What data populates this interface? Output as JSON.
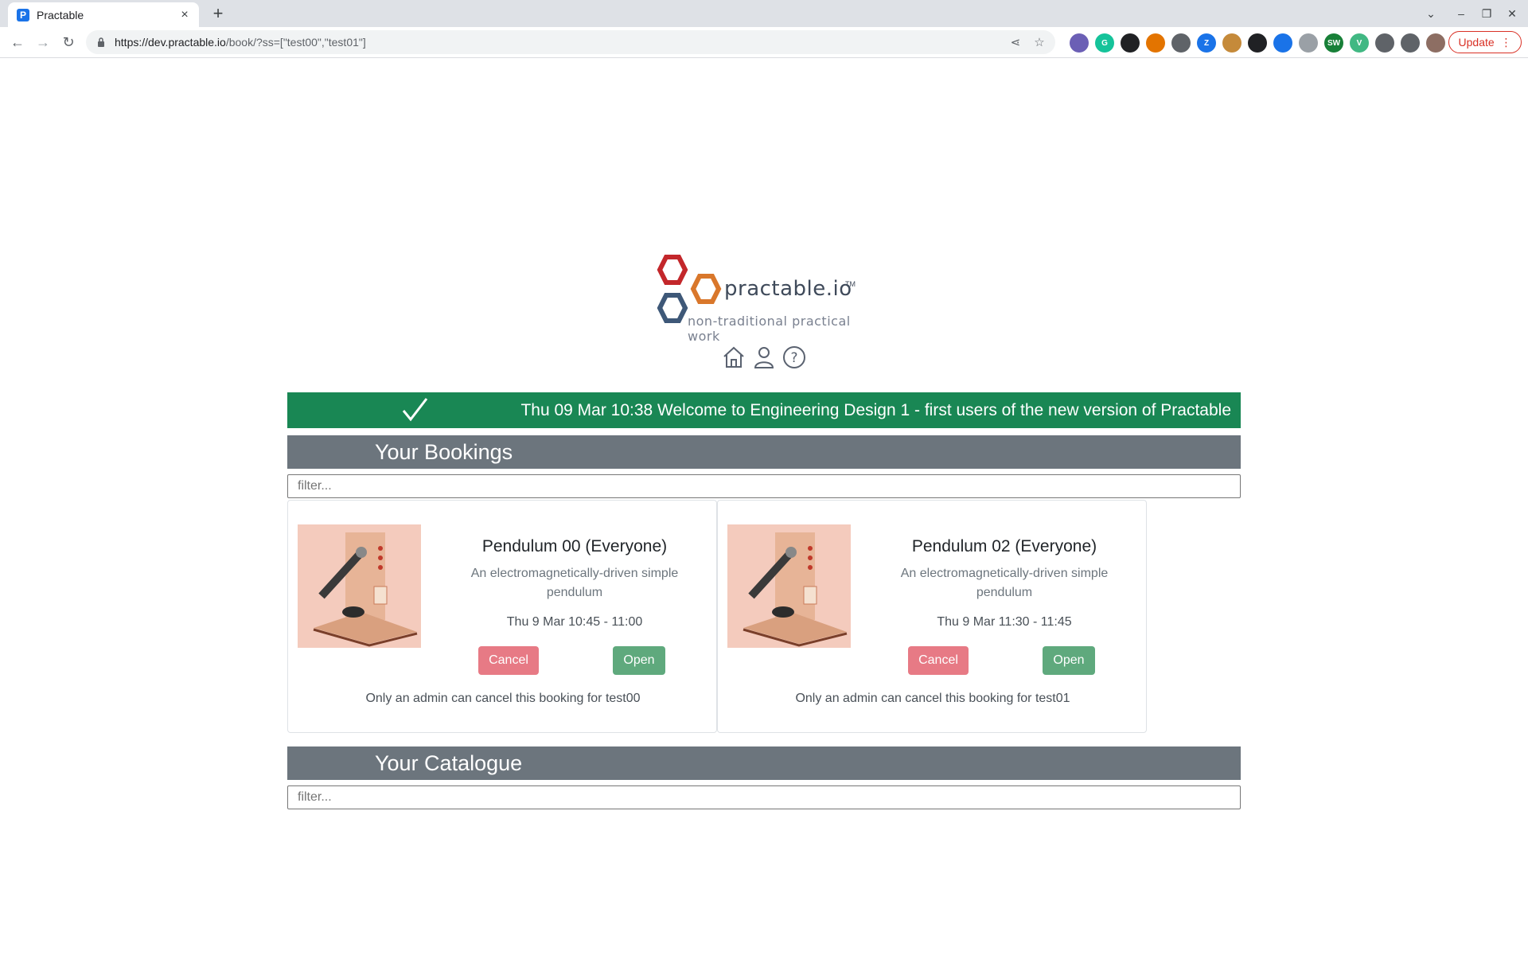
{
  "browser": {
    "tab_title": "Practable",
    "tab_favicon": "P",
    "url_host": "https://dev.practable.io",
    "url_path": "/book/?ss=[\"test00\",\"test01\"]",
    "update_label": "Update",
    "extensions": [
      {
        "icon": "globe-ext-icon",
        "label": "",
        "color": "#6b5fb5"
      },
      {
        "icon": "grammarly-icon",
        "label": "G",
        "color": "#15c39a"
      },
      {
        "icon": "sync-icon",
        "label": "",
        "color": "#202124"
      },
      {
        "icon": "rainbow-icon",
        "label": "",
        "color": "#e37400"
      },
      {
        "icon": "pulse-icon",
        "label": "",
        "color": "#5f6368"
      },
      {
        "icon": "zotero-icon",
        "label": "Z",
        "color": "#1a73e8"
      },
      {
        "icon": "cookie-icon",
        "label": "",
        "color": "#c58a3a"
      },
      {
        "icon": "cam-icon",
        "label": "",
        "color": "#202124"
      },
      {
        "icon": "wave-icon",
        "label": "",
        "color": "#1a73e8"
      },
      {
        "icon": "doc-icon",
        "label": "",
        "color": "#9aa0a6"
      },
      {
        "icon": "sw-icon",
        "label": "SW",
        "color": "#188038"
      },
      {
        "icon": "vue-icon",
        "label": "V",
        "color": "#41b883"
      },
      {
        "icon": "puzzle-icon",
        "label": "",
        "color": "#5f6368"
      },
      {
        "icon": "sidepanel-icon",
        "label": "",
        "color": "#5f6368"
      },
      {
        "icon": "avatar-icon",
        "label": "",
        "color": "#8d6e63"
      }
    ]
  },
  "logo": {
    "wordmark": "practable.io",
    "tm": "TM",
    "tagline": "non-traditional practical work",
    "colors": {
      "red": "#c3272b",
      "orange": "#d9772b",
      "blue": "#3e5878"
    }
  },
  "banner": {
    "text": "Thu 09 Mar 10:38 Welcome to Engineering Design 1 - first users of the new version of Practable",
    "color": "#198754"
  },
  "bookings": {
    "title": "Your Bookings",
    "filter_placeholder": "filter...",
    "items": [
      {
        "name": "Pendulum 00 (Everyone)",
        "description": "An electromagnetically-driven simple pendulum",
        "time": "Thu 9 Mar 10:45 - 11:00",
        "cancel_label": "Cancel",
        "open_label": "Open",
        "note": "Only an admin can cancel this booking for test00"
      },
      {
        "name": "Pendulum 02 (Everyone)",
        "description": "An electromagnetically-driven simple pendulum",
        "time": "Thu 9 Mar 11:30 - 11:45",
        "cancel_label": "Cancel",
        "open_label": "Open",
        "note": "Only an admin can cancel this booking for test01"
      }
    ]
  },
  "catalogue": {
    "title": "Your Catalogue",
    "filter_placeholder": "filter..."
  }
}
